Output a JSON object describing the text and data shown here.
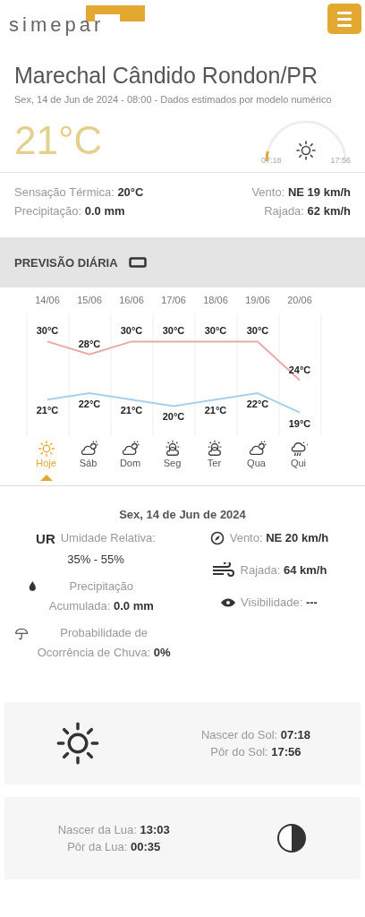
{
  "header": {
    "logo": "simepar"
  },
  "location": {
    "title": "Marechal Cândido Rondon/PR",
    "subtitle": "Sex, 14 de Jun de 2024 - 08:00 - Dados estimados por modelo numérico",
    "temperature": "21°C",
    "sun_arc": {
      "sunrise": "07:18",
      "sunset": "17:56"
    }
  },
  "current": [
    {
      "label": "Sensação Térmica:",
      "value": "20°C"
    },
    {
      "label": "Vento:",
      "value": "NE 19 km/h"
    },
    {
      "label": "Precipitação:",
      "value": "0.0 mm"
    },
    {
      "label": "Rajada:",
      "value": "62 km/h"
    }
  ],
  "section_title": "PREVISÃO DIÁRIA",
  "forecast": {
    "chart_data": {
      "type": "line",
      "categories": [
        "14/06",
        "15/06",
        "16/06",
        "17/06",
        "18/06",
        "19/06",
        "20/06"
      ],
      "data_labels": true,
      "series": [
        {
          "color": "#eaa9a9",
          "values": [
            30,
            28,
            30,
            30,
            30,
            30,
            24
          ],
          "value_labels": [
            "30°C",
            "28°C",
            "30°C",
            "30°C",
            "30°C",
            "30°C",
            "24°C"
          ]
        },
        {
          "color": "#a9d0ea",
          "values": [
            21,
            22,
            21,
            20,
            21,
            22,
            19
          ],
          "value_labels": [
            "21°C",
            "22°C",
            "21°C",
            "20°C",
            "21°C",
            "22°C",
            "19°C"
          ]
        }
      ]
    },
    "days": [
      {
        "label": "Hoje",
        "kind": "sun",
        "selected": true
      },
      {
        "label": "Sáb",
        "kind": "cloud-sun",
        "selected": false
      },
      {
        "label": "Dom",
        "kind": "cloud-sun",
        "selected": false
      },
      {
        "label": "Seg",
        "kind": "sun-cloud",
        "selected": false
      },
      {
        "label": "Ter",
        "kind": "sun-cloud",
        "selected": false
      },
      {
        "label": "Qua",
        "kind": "cloud-sun",
        "selected": false
      },
      {
        "label": "Qui",
        "kind": "rain",
        "selected": false
      }
    ]
  },
  "details": {
    "date": "Sex, 14 de Jun de 2024",
    "humidity": {
      "badge": "UR",
      "label": "Umidade Relativa:",
      "value": "35% - 55%"
    },
    "precipitation": {
      "label": "Precipitação Acumulada:",
      "value": "0.0 mm"
    },
    "rain_probability": {
      "label": "Probabilidade de Ocorrência de Chuva:",
      "value": "0%"
    },
    "right": [
      {
        "kind": "wind",
        "label": "Vento:",
        "value": "NE 20 km/h"
      },
      {
        "kind": "gust",
        "label": "Rajada:",
        "value": "64 km/h"
      },
      {
        "kind": "visibility",
        "label": "Visibilidade:",
        "value": "---"
      }
    ]
  },
  "sun": [
    {
      "label": "Nascer do Sol:",
      "value": "07:18"
    },
    {
      "label": "Pôr do Sol:",
      "value": "17:56"
    }
  ],
  "moon": [
    {
      "label": "Nascer da Lua:",
      "value": "13:03"
    },
    {
      "label": "Pôr da Lua:",
      "value": "00:35"
    }
  ]
}
